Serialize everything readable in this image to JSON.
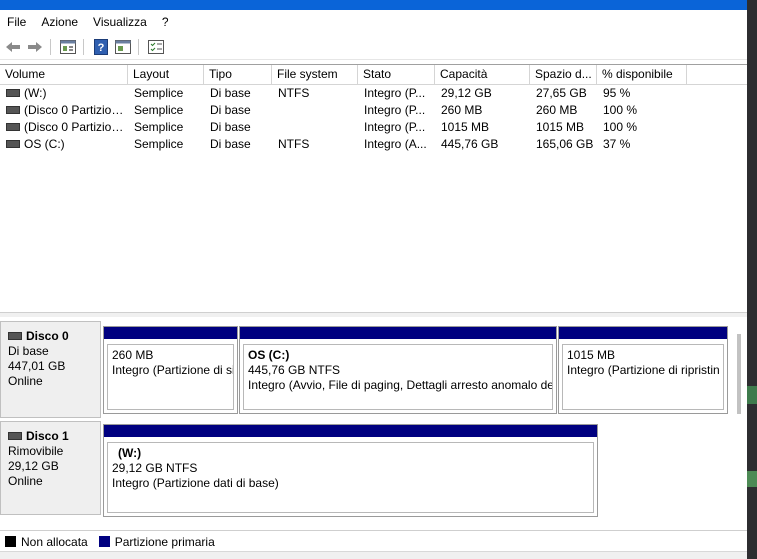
{
  "menu": [
    "File",
    "Azione",
    "Visualizza",
    "?"
  ],
  "toolbar": [
    "back-arrow-icon",
    "forward-arrow-icon",
    "properties-icon",
    "help-icon",
    "console-tree-icon",
    "checklist-icon"
  ],
  "columns": [
    "Volume",
    "Layout",
    "Tipo",
    "File system",
    "Stato",
    "Capacità",
    "Spazio d...",
    "% disponibile"
  ],
  "volumes": [
    {
      "name": "(W:)",
      "layout": "Semplice",
      "tipo": "Di base",
      "fs": "NTFS",
      "stato": "Integro (P...",
      "capacita": "29,12 GB",
      "spazio": "27,65 GB",
      "pct": "95 %"
    },
    {
      "name": "(Disco 0 Partizione...",
      "layout": "Semplice",
      "tipo": "Di base",
      "fs": "",
      "stato": "Integro (P...",
      "capacita": "260 MB",
      "spazio": "260 MB",
      "pct": "100 %"
    },
    {
      "name": "(Disco 0 Partizione...",
      "layout": "Semplice",
      "tipo": "Di base",
      "fs": "",
      "stato": "Integro (P...",
      "capacita": "1015 MB",
      "spazio": "1015 MB",
      "pct": "100 %"
    },
    {
      "name": "OS (C:)",
      "layout": "Semplice",
      "tipo": "Di base",
      "fs": "NTFS",
      "stato": "Integro (A...",
      "capacita": "445,76 GB",
      "spazio": "165,06 GB",
      "pct": "37 %"
    }
  ],
  "disks": [
    {
      "name": "Disco 0",
      "type": "Di base",
      "size": "447,01 GB",
      "status": "Online",
      "partitions": [
        {
          "label": "",
          "size": "260 MB",
          "status": "Integro (Partizione di si"
        },
        {
          "label": "OS  (C:)",
          "size": "445,76 GB NTFS",
          "status": "Integro (Avvio, File di paging, Dettagli arresto anomalo de"
        },
        {
          "label": "",
          "size": "1015 MB",
          "status": "Integro (Partizione di ripristin"
        }
      ]
    },
    {
      "name": "Disco 1",
      "type": "Rimovibile",
      "size": "29,12 GB",
      "status": "Online",
      "partitions": [
        {
          "label": "(W:)",
          "size": "29,12 GB NTFS",
          "status": "Integro (Partizione dati di base)"
        }
      ]
    }
  ],
  "legend": [
    {
      "label": "Non allocata",
      "color": "#000000"
    },
    {
      "label": "Partizione primaria",
      "color": "#000080"
    }
  ],
  "colors": {
    "primary_partition_bar": "#000080",
    "title_strip": "#0a64d8"
  }
}
